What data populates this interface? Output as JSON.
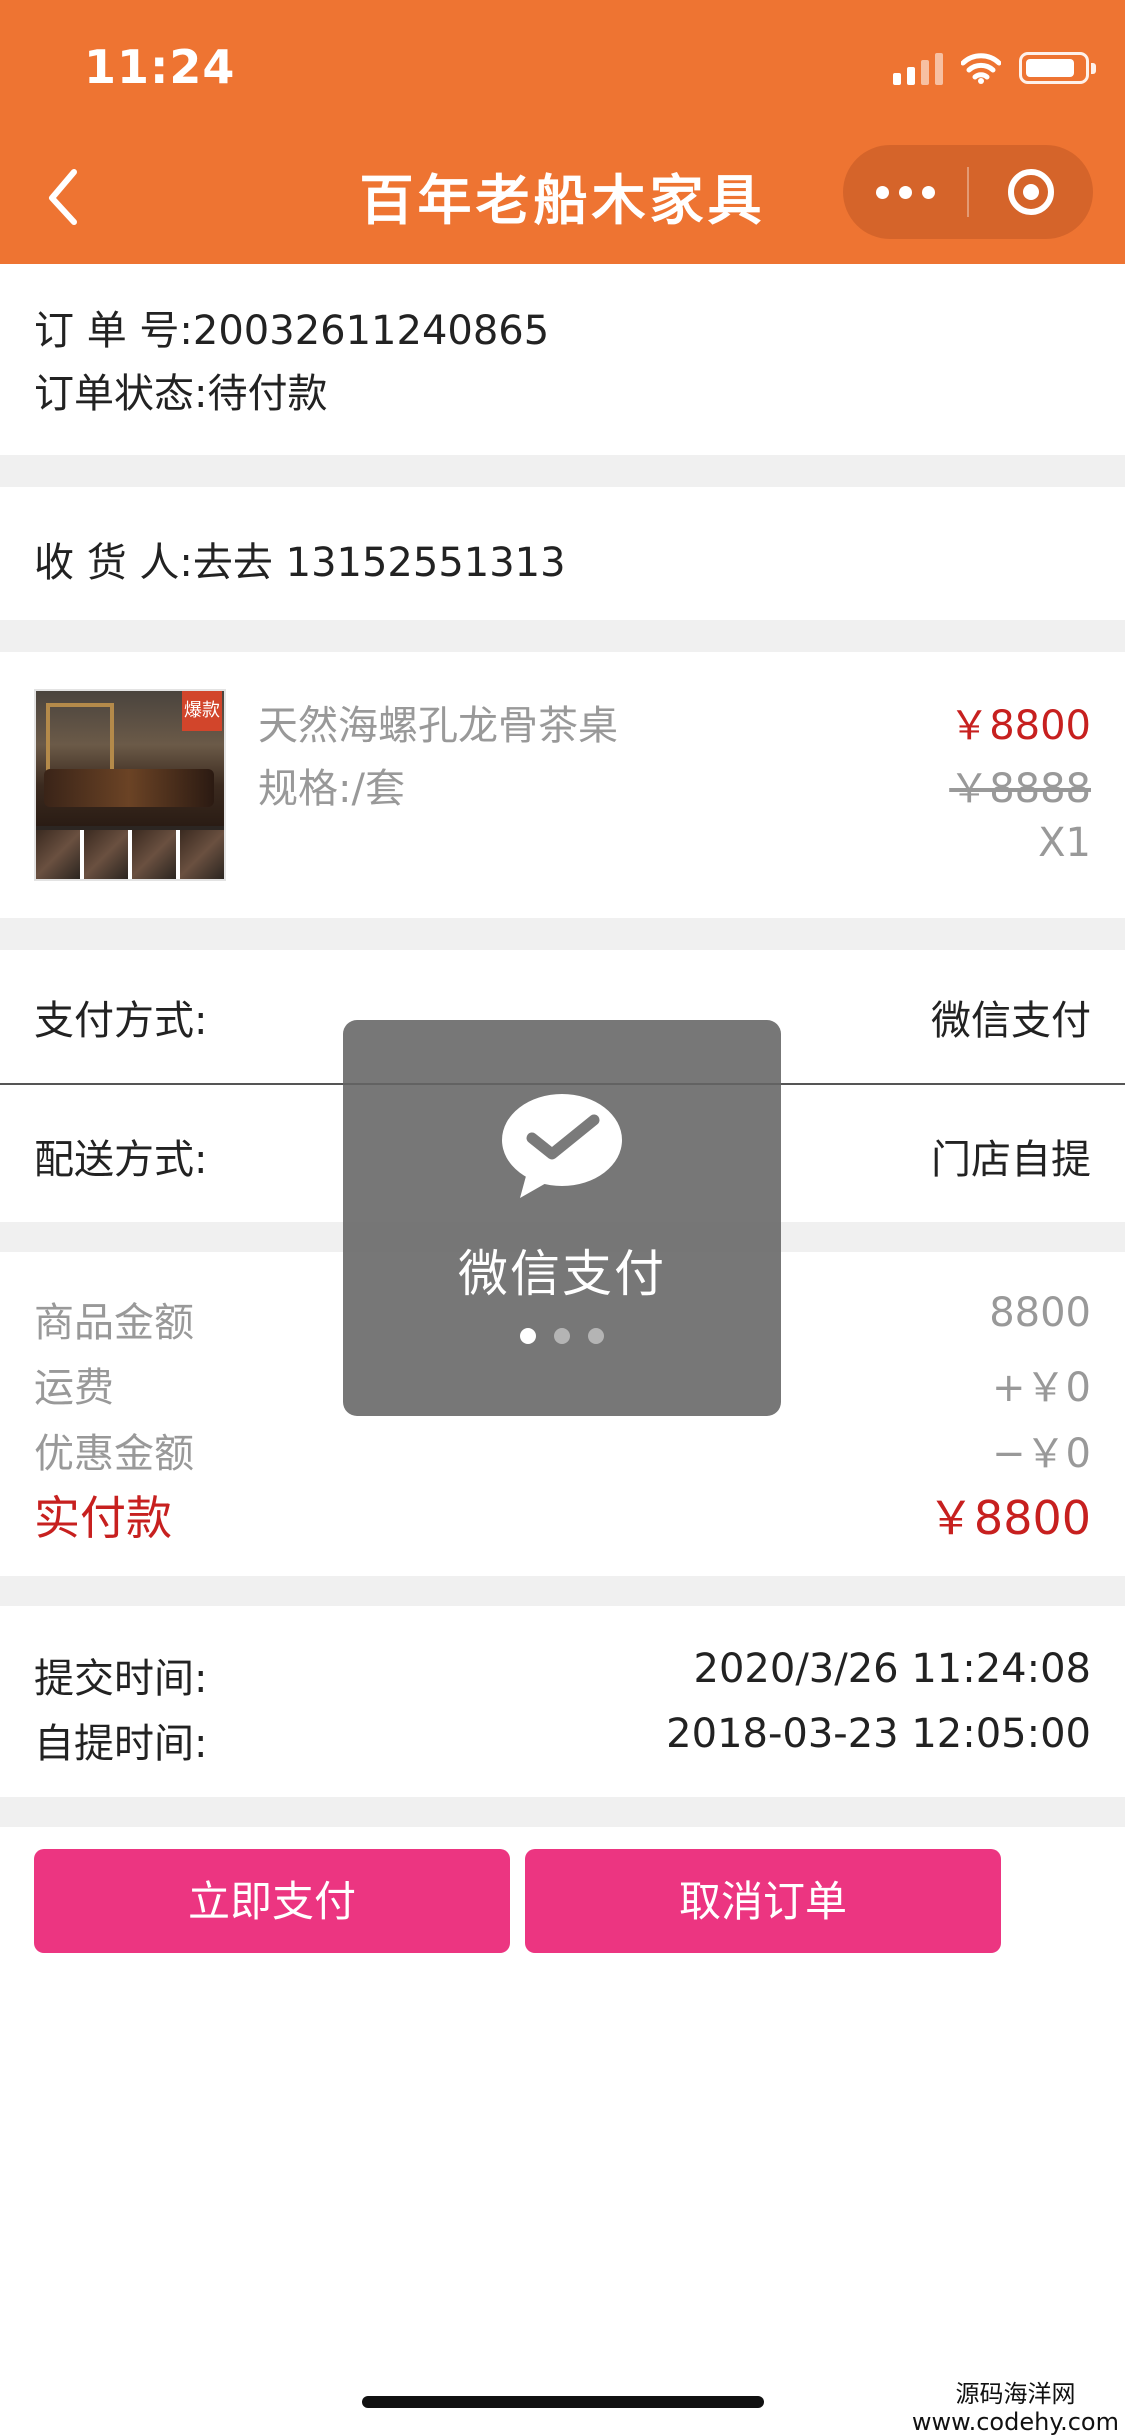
{
  "status_bar": {
    "time": "11:24"
  },
  "header": {
    "title": "百年老船木家具",
    "back_icon": "chevron-left-icon",
    "more_icon": "more-dots-icon",
    "close_icon": "target-circle-icon",
    "bg_color": "#EE7432"
  },
  "order": {
    "number": "订 单 号:20032611240865",
    "status": "订单状态:待付款"
  },
  "receiver": {
    "text": "收 货 人:去去 13152551313"
  },
  "product": {
    "name": "天然海螺孔龙骨茶桌",
    "spec": "规格:/套",
    "price": "￥8800",
    "original_price": "￥8888",
    "quantity": "X1",
    "badge": "爆款"
  },
  "payment": {
    "label": "支付方式:",
    "value": "微信支付"
  },
  "delivery": {
    "label": "配送方式:",
    "value": "门店自提"
  },
  "summary": {
    "goods_label": "商品金额",
    "goods_value": "8800",
    "shipping_label": "运费",
    "shipping_value": "+￥0",
    "discount_label": "优惠金额",
    "discount_value": "−￥0",
    "paid_label": "实付款",
    "paid_value": "￥8800"
  },
  "times": {
    "submit_label": "提交时间:",
    "submit_value": "2020/3/26 11:24:08",
    "pickup_label": "自提时间:",
    "pickup_value": "2018-03-23 12:05:00"
  },
  "actions": {
    "pay_now": "立即支付",
    "cancel_order": "取消订单",
    "button_color": "#EC3581"
  },
  "toast": {
    "text": "微信支付",
    "icon": "wechat-pay-icon"
  },
  "watermark": {
    "line1": "源码海洋网",
    "line2": "www.codehy.com"
  }
}
